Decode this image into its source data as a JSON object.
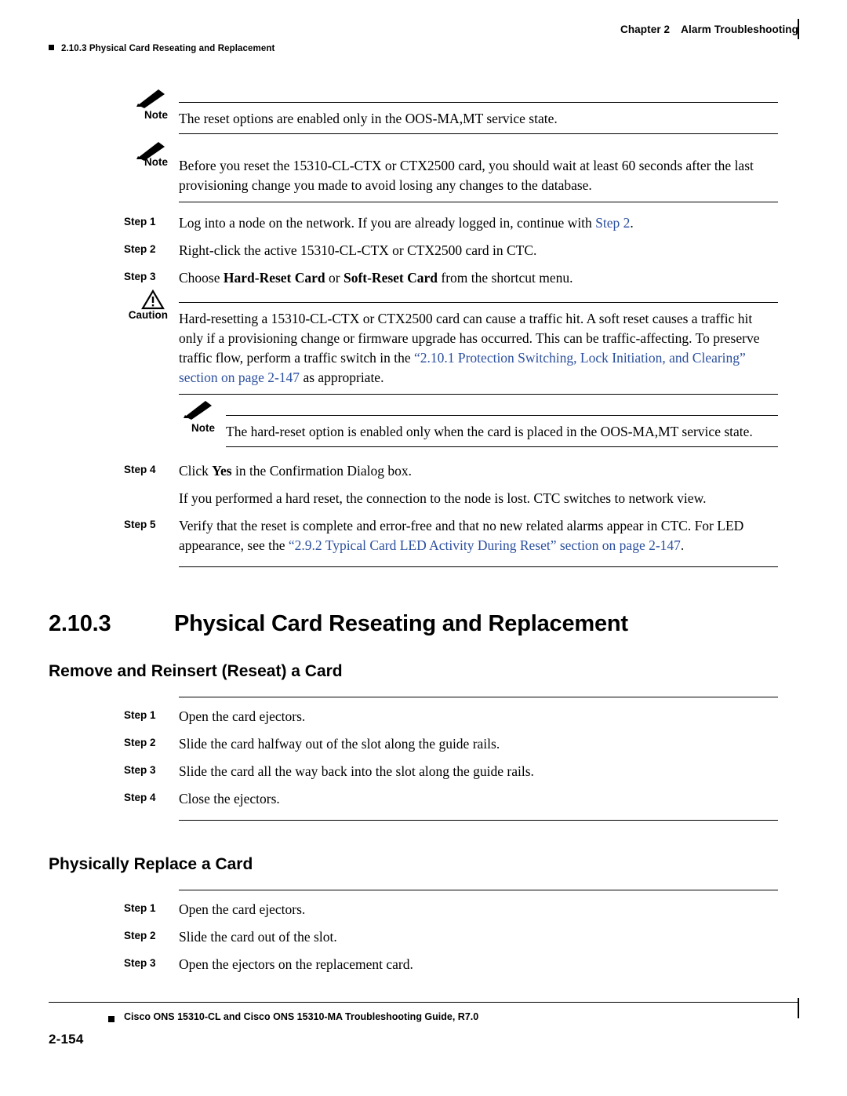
{
  "header": {
    "chapter": "Chapter 2",
    "chapter_title": "Alarm Troubleshooting",
    "section_crumb": "2.10.3  Physical Card Reseating and Replacement"
  },
  "notes": {
    "note1_label": "Note",
    "note1_text": "The reset options are enabled only in the OOS-MA,MT service state.",
    "note2_label": "Note",
    "note2_text": "Before you reset the 15310-CL-CTX or CTX2500 card, you should wait at least 60 seconds after the last provisioning change you made to avoid losing any changes to the database.",
    "caution_label": "Caution",
    "caution_text_1": "Hard-resetting a 15310-CL-CTX or CTX2500 card can cause a traffic hit. A soft reset causes a traffic hit only if a provisioning change or firmware upgrade has occurred. This can be traffic-affecting. To preserve traffic flow, perform a traffic switch in the ",
    "caution_link": "“2.10.1  Protection Switching, Lock Initiation, and Clearing” section on page 2-147",
    "caution_text_2": " as appropriate.",
    "note3_label": "Note",
    "note3_text": "The hard-reset option is enabled only when the card is placed in the OOS-MA,MT service state."
  },
  "reset_steps": {
    "step1_label": "Step 1",
    "step1_text_a": "Log into a node on the network. If you are already logged in, continue with ",
    "step1_link": "Step 2",
    "step1_text_b": ".",
    "step2_label": "Step 2",
    "step2_text": "Right-click the active 15310-CL-CTX or CTX2500 card in CTC.",
    "step3_label": "Step 3",
    "step3_text_a": "Choose ",
    "step3_bold_1": "Hard-Reset Card",
    "step3_text_b": " or ",
    "step3_bold_2": "Soft-Reset Card",
    "step3_text_c": " from the shortcut menu.",
    "step4_label": "Step 4",
    "step4_text_a": "Click ",
    "step4_bold": "Yes",
    "step4_text_b": " in the Confirmation Dialog box.",
    "step4_cont": "If you performed a hard reset, the connection to the node is lost. CTC switches to network view.",
    "step5_label": "Step 5",
    "step5_text_a": "Verify that the reset is complete and error-free and that no new related alarms appear in CTC. For LED appearance, see the ",
    "step5_link": "“2.9.2  Typical Card LED Activity During Reset” section on page 2-147",
    "step5_text_b": "."
  },
  "section": {
    "heading_number": "2.10.3",
    "heading_title": "Physical Card Reseating and Replacement",
    "sub1_title": "Remove and Reinsert (Reseat) a Card",
    "sub2_title": "Physically Replace a Card"
  },
  "reseat_steps": [
    {
      "label": "Step 1",
      "text": "Open the card ejectors."
    },
    {
      "label": "Step 2",
      "text": "Slide the card halfway out of the slot along the guide rails."
    },
    {
      "label": "Step 3",
      "text": "Slide the card all the way back into the slot along the guide rails."
    },
    {
      "label": "Step 4",
      "text": "Close the ejectors."
    }
  ],
  "replace_steps": [
    {
      "label": "Step 1",
      "text": "Open the card ejectors."
    },
    {
      "label": "Step 2",
      "text": "Slide the card out of the slot."
    },
    {
      "label": "Step 3",
      "text": "Open the ejectors on the replacement card."
    }
  ],
  "footer": {
    "title": "Cisco ONS 15310-CL and Cisco ONS 15310-MA Troubleshooting Guide, R7.0",
    "page": "2-154"
  },
  "colors": {
    "link": "#2b4f9e",
    "text": "#000000"
  }
}
